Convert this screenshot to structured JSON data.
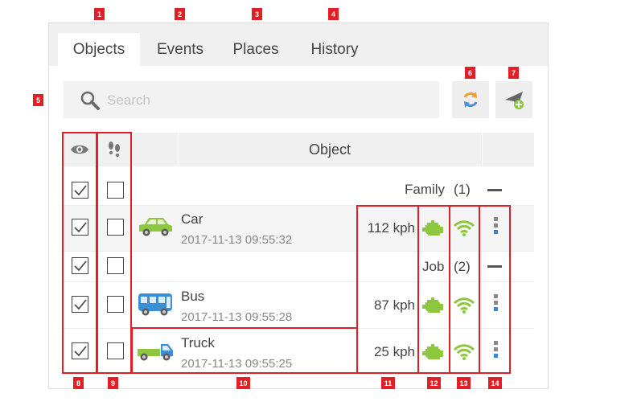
{
  "tabs": [
    {
      "label": "Objects",
      "active": true
    },
    {
      "label": "Events"
    },
    {
      "label": "Places"
    },
    {
      "label": "History"
    }
  ],
  "search": {
    "placeholder": "Search"
  },
  "table": {
    "object_header": "Object"
  },
  "groups": [
    {
      "name": "Family",
      "count": "(1)"
    },
    {
      "name": "Job",
      "count": "(2)"
    }
  ],
  "objects": [
    {
      "name": "Car",
      "time": "2017-11-13 09:55:32",
      "speed": "112 kph",
      "icon": "car-icon"
    },
    {
      "name": "Bus",
      "time": "2017-11-13 09:55:28",
      "speed": "87 kph",
      "icon": "bus-icon"
    },
    {
      "name": "Truck",
      "time": "2017-11-13 09:55:25",
      "speed": "25 kph",
      "icon": "truck-icon"
    }
  ],
  "annotations": [
    "1",
    "2",
    "3",
    "4",
    "5",
    "6",
    "7",
    "8",
    "9",
    "10",
    "11",
    "12",
    "13",
    "14"
  ],
  "colors": {
    "annotation": "#e21e26",
    "status_green": "#8dc63f",
    "refresh_orange": "#f0a030",
    "refresh_blue": "#4a90d9",
    "menu_blue": "#3a86d1"
  }
}
